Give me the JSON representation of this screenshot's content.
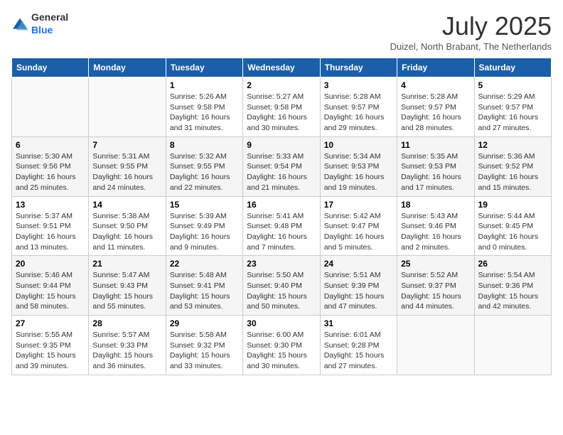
{
  "header": {
    "logo_general": "General",
    "logo_blue": "Blue",
    "month_title": "July 2025",
    "subtitle": "Duizel, North Brabant, The Netherlands"
  },
  "calendar": {
    "headers": [
      "Sunday",
      "Monday",
      "Tuesday",
      "Wednesday",
      "Thursday",
      "Friday",
      "Saturday"
    ],
    "weeks": [
      [
        {
          "day": "",
          "info": ""
        },
        {
          "day": "",
          "info": ""
        },
        {
          "day": "1",
          "info": "Sunrise: 5:26 AM\nSunset: 9:58 PM\nDaylight: 16 hours and 31 minutes."
        },
        {
          "day": "2",
          "info": "Sunrise: 5:27 AM\nSunset: 9:58 PM\nDaylight: 16 hours and 30 minutes."
        },
        {
          "day": "3",
          "info": "Sunrise: 5:28 AM\nSunset: 9:57 PM\nDaylight: 16 hours and 29 minutes."
        },
        {
          "day": "4",
          "info": "Sunrise: 5:28 AM\nSunset: 9:57 PM\nDaylight: 16 hours and 28 minutes."
        },
        {
          "day": "5",
          "info": "Sunrise: 5:29 AM\nSunset: 9:57 PM\nDaylight: 16 hours and 27 minutes."
        }
      ],
      [
        {
          "day": "6",
          "info": "Sunrise: 5:30 AM\nSunset: 9:56 PM\nDaylight: 16 hours and 25 minutes."
        },
        {
          "day": "7",
          "info": "Sunrise: 5:31 AM\nSunset: 9:55 PM\nDaylight: 16 hours and 24 minutes."
        },
        {
          "day": "8",
          "info": "Sunrise: 5:32 AM\nSunset: 9:55 PM\nDaylight: 16 hours and 22 minutes."
        },
        {
          "day": "9",
          "info": "Sunrise: 5:33 AM\nSunset: 9:54 PM\nDaylight: 16 hours and 21 minutes."
        },
        {
          "day": "10",
          "info": "Sunrise: 5:34 AM\nSunset: 9:53 PM\nDaylight: 16 hours and 19 minutes."
        },
        {
          "day": "11",
          "info": "Sunrise: 5:35 AM\nSunset: 9:53 PM\nDaylight: 16 hours and 17 minutes."
        },
        {
          "day": "12",
          "info": "Sunrise: 5:36 AM\nSunset: 9:52 PM\nDaylight: 16 hours and 15 minutes."
        }
      ],
      [
        {
          "day": "13",
          "info": "Sunrise: 5:37 AM\nSunset: 9:51 PM\nDaylight: 16 hours and 13 minutes."
        },
        {
          "day": "14",
          "info": "Sunrise: 5:38 AM\nSunset: 9:50 PM\nDaylight: 16 hours and 11 minutes."
        },
        {
          "day": "15",
          "info": "Sunrise: 5:39 AM\nSunset: 9:49 PM\nDaylight: 16 hours and 9 minutes."
        },
        {
          "day": "16",
          "info": "Sunrise: 5:41 AM\nSunset: 9:48 PM\nDaylight: 16 hours and 7 minutes."
        },
        {
          "day": "17",
          "info": "Sunrise: 5:42 AM\nSunset: 9:47 PM\nDaylight: 16 hours and 5 minutes."
        },
        {
          "day": "18",
          "info": "Sunrise: 5:43 AM\nSunset: 9:46 PM\nDaylight: 16 hours and 2 minutes."
        },
        {
          "day": "19",
          "info": "Sunrise: 5:44 AM\nSunset: 9:45 PM\nDaylight: 16 hours and 0 minutes."
        }
      ],
      [
        {
          "day": "20",
          "info": "Sunrise: 5:46 AM\nSunset: 9:44 PM\nDaylight: 15 hours and 58 minutes."
        },
        {
          "day": "21",
          "info": "Sunrise: 5:47 AM\nSunset: 9:43 PM\nDaylight: 15 hours and 55 minutes."
        },
        {
          "day": "22",
          "info": "Sunrise: 5:48 AM\nSunset: 9:41 PM\nDaylight: 15 hours and 53 minutes."
        },
        {
          "day": "23",
          "info": "Sunrise: 5:50 AM\nSunset: 9:40 PM\nDaylight: 15 hours and 50 minutes."
        },
        {
          "day": "24",
          "info": "Sunrise: 5:51 AM\nSunset: 9:39 PM\nDaylight: 15 hours and 47 minutes."
        },
        {
          "day": "25",
          "info": "Sunrise: 5:52 AM\nSunset: 9:37 PM\nDaylight: 15 hours and 44 minutes."
        },
        {
          "day": "26",
          "info": "Sunrise: 5:54 AM\nSunset: 9:36 PM\nDaylight: 15 hours and 42 minutes."
        }
      ],
      [
        {
          "day": "27",
          "info": "Sunrise: 5:55 AM\nSunset: 9:35 PM\nDaylight: 15 hours and 39 minutes."
        },
        {
          "day": "28",
          "info": "Sunrise: 5:57 AM\nSunset: 9:33 PM\nDaylight: 15 hours and 36 minutes."
        },
        {
          "day": "29",
          "info": "Sunrise: 5:58 AM\nSunset: 9:32 PM\nDaylight: 15 hours and 33 minutes."
        },
        {
          "day": "30",
          "info": "Sunrise: 6:00 AM\nSunset: 9:30 PM\nDaylight: 15 hours and 30 minutes."
        },
        {
          "day": "31",
          "info": "Sunrise: 6:01 AM\nSunset: 9:28 PM\nDaylight: 15 hours and 27 minutes."
        },
        {
          "day": "",
          "info": ""
        },
        {
          "day": "",
          "info": ""
        }
      ]
    ]
  }
}
